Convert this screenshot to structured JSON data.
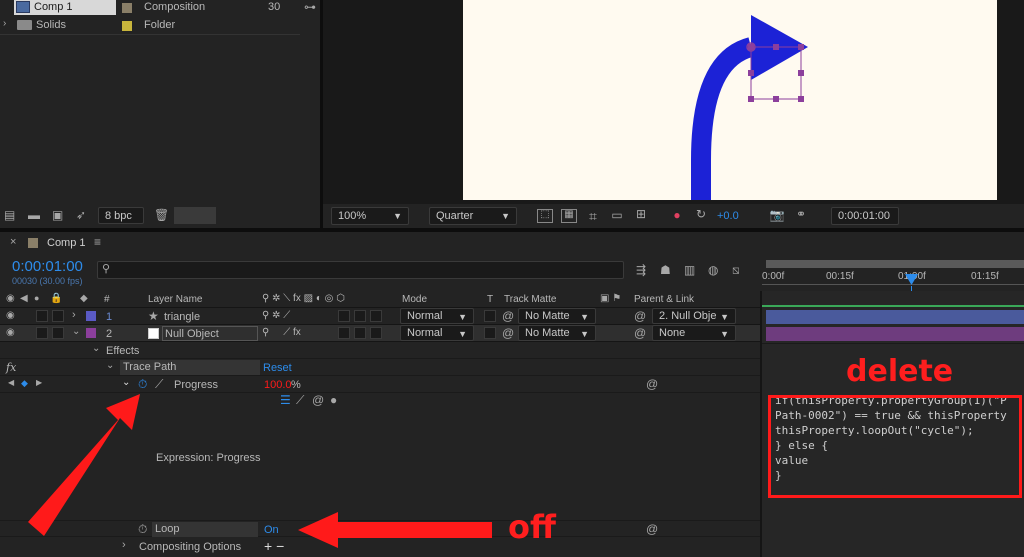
{
  "project": {
    "items": [
      {
        "name": "Comp 1",
        "type": "Composition",
        "fps": "30",
        "swatch": "#8a7f68"
      },
      {
        "name": "Solids",
        "type": "Folder",
        "fps": "",
        "swatch": "#c8b53c"
      }
    ],
    "bpc": "8 bpc"
  },
  "viewer": {
    "zoom": "100%",
    "resolution": "Quarter",
    "exposure": "+0.0",
    "timecode": "0:00:01:00"
  },
  "timeline": {
    "comp_tab": "Comp 1",
    "current_time": "0:00:01:00",
    "frame_info": "00030 (30.00 fps)",
    "search_placeholder": "",
    "ruler": [
      "0:00f",
      "00:15f",
      "01:00f",
      "01:15f"
    ],
    "headers": {
      "layer_name": "Layer Name",
      "mode": "Mode",
      "t": "T",
      "track_matte": "Track Matte",
      "parent": "Parent & Link",
      "hash": "#"
    },
    "layers": [
      {
        "num": "1",
        "name": "triangle",
        "mode": "Normal",
        "matte": "No Matte",
        "parent": "2. Null Obje",
        "color": "#5a5ac4"
      },
      {
        "num": "2",
        "name": "Null Object",
        "mode": "Normal",
        "matte": "No Matte",
        "parent": "None",
        "color": "#8c3f9c"
      }
    ],
    "effects_label": "Effects",
    "fx_label": "fx",
    "trace_path": "Trace Path",
    "reset": "Reset",
    "progress_label": "Progress",
    "progress_value": "100.0",
    "progress_unit": "%",
    "expression_label": "Expression: Progress",
    "loop_label": "Loop",
    "loop_value": "On",
    "compositing": "Compositing Options",
    "add_remove": "+ −"
  },
  "expression": {
    "lines": [
      "if(thisProperty.propertyGroup(1)(\"P",
      "Path-0002\") == true && thisProperty",
      "thisProperty.loopOut(\"cycle\");",
      "} else {",
      "value",
      "}"
    ]
  },
  "annotations": {
    "delete": "delete",
    "off": "off"
  },
  "colors": {
    "accent_blue": "#2d8ceb",
    "arrow_red": "#ff1a1a",
    "path_blue": "#1c22d6",
    "canvas": "#fffaf0"
  }
}
